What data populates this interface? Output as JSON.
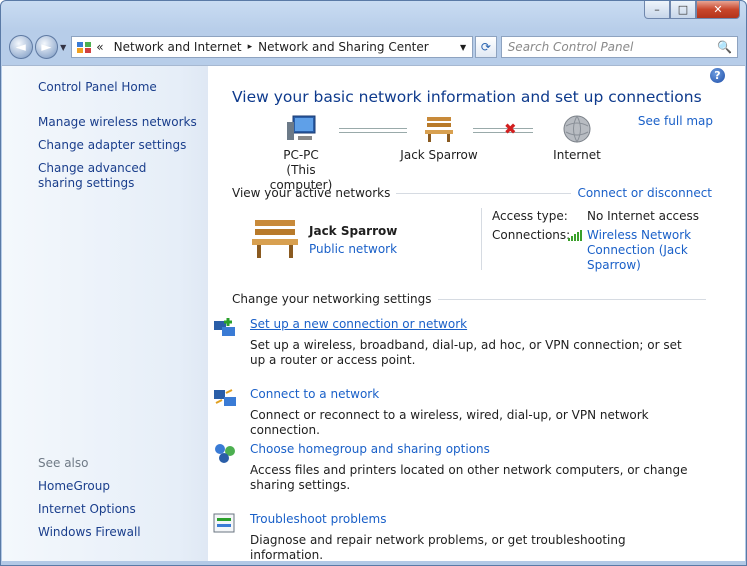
{
  "window": {
    "minimize": "–",
    "maximize": "□",
    "close": "✕"
  },
  "nav": {
    "back": "◄",
    "forward": "►",
    "breadcrumb_prefix": "«",
    "breadcrumbs": [
      "Network and Internet",
      "Network and Sharing Center"
    ],
    "breadcrumb_sep": "▸",
    "refresh": "⟳",
    "search_placeholder": "Search Control Panel",
    "search_icon": "🔍"
  },
  "sidebar": {
    "home": "Control Panel Home",
    "items": [
      "Manage wireless networks",
      "Change adapter settings",
      "Change advanced sharing settings"
    ],
    "see_also_label": "See also",
    "see_also": [
      "HomeGroup",
      "Internet Options",
      "Windows Firewall"
    ]
  },
  "main": {
    "help_icon": "?",
    "title": "View your basic network information and set up connections",
    "see_full_map": "See full map",
    "map": {
      "computer": "PC-PC",
      "computer_sub": "(This computer)",
      "network": "Jack Sparrow",
      "internet": "Internet",
      "broken_link": "✖"
    },
    "active": {
      "heading": "View your active networks",
      "connect_link": "Connect or disconnect",
      "network_name": "Jack Sparrow",
      "network_type": "Public network",
      "access_type_label": "Access type:",
      "access_type_value": "No Internet access",
      "connections_label": "Connections:",
      "connections_value": "Wireless Network Connection (Jack Sparrow)"
    },
    "change": {
      "heading": "Change your networking settings",
      "tasks": [
        {
          "link": "Set up a new connection or network",
          "desc": "Set up a wireless, broadband, dial-up, ad hoc, or VPN connection; or set up a router or access point."
        },
        {
          "link": "Connect to a network",
          "desc": "Connect or reconnect to a wireless, wired, dial-up, or VPN network connection."
        },
        {
          "link": "Choose homegroup and sharing options",
          "desc": "Access files and printers located on other network computers, or change sharing settings."
        },
        {
          "link": "Troubleshoot problems",
          "desc": "Diagnose and repair network problems, or get troubleshooting information."
        }
      ]
    }
  },
  "colors": {
    "link": "#1a60c8",
    "title": "#0e3a8c",
    "close": "#c8462b"
  }
}
